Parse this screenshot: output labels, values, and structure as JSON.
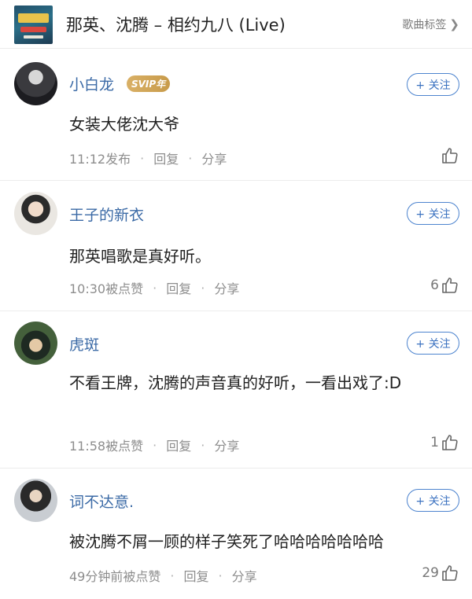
{
  "header": {
    "title": "那英、沈腾 – 相约九八 (Live)",
    "tag_label": "歌曲标签",
    "tag_chevron": "chevron-right-icon",
    "cover_icon": "album-cover"
  },
  "follow_label": "+ 关注",
  "meta_reply": "回复",
  "meta_share": "分享",
  "meta_dot": "·",
  "comments": [
    {
      "username": "小白龙",
      "badge": "SVIP年",
      "text": "女装大佬沈大爷",
      "meta": "11:12发布",
      "likes": ""
    },
    {
      "username": "王子的新衣",
      "text": "那英唱歌是真好听。",
      "meta": "10:30被点赞",
      "likes": "6"
    },
    {
      "username": "虎斑",
      "text": "不看王牌，沈腾的声音真的好听，一看出戏了:D",
      "meta": "11:58被点赞",
      "likes": "1"
    },
    {
      "username": "词不达意.",
      "text": "被沈腾不屑一顾的样子笑死了哈哈哈哈哈哈哈",
      "meta": "49分钟前被点赞",
      "likes": "29"
    }
  ],
  "colors": {
    "username": "#3b6aa6",
    "follow": "#3b72c0",
    "vip": "#c89b4a"
  }
}
